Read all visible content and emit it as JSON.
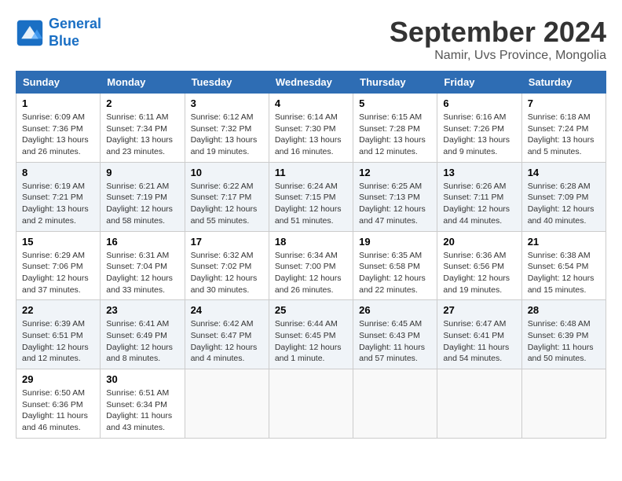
{
  "header": {
    "logo_line1": "General",
    "logo_line2": "Blue",
    "month": "September 2024",
    "location": "Namir, Uvs Province, Mongolia"
  },
  "weekdays": [
    "Sunday",
    "Monday",
    "Tuesday",
    "Wednesday",
    "Thursday",
    "Friday",
    "Saturday"
  ],
  "weeks": [
    [
      {
        "day": "1",
        "content": "Sunrise: 6:09 AM\nSunset: 7:36 PM\nDaylight: 13 hours\nand 26 minutes."
      },
      {
        "day": "2",
        "content": "Sunrise: 6:11 AM\nSunset: 7:34 PM\nDaylight: 13 hours\nand 23 minutes."
      },
      {
        "day": "3",
        "content": "Sunrise: 6:12 AM\nSunset: 7:32 PM\nDaylight: 13 hours\nand 19 minutes."
      },
      {
        "day": "4",
        "content": "Sunrise: 6:14 AM\nSunset: 7:30 PM\nDaylight: 13 hours\nand 16 minutes."
      },
      {
        "day": "5",
        "content": "Sunrise: 6:15 AM\nSunset: 7:28 PM\nDaylight: 13 hours\nand 12 minutes."
      },
      {
        "day": "6",
        "content": "Sunrise: 6:16 AM\nSunset: 7:26 PM\nDaylight: 13 hours\nand 9 minutes."
      },
      {
        "day": "7",
        "content": "Sunrise: 6:18 AM\nSunset: 7:24 PM\nDaylight: 13 hours\nand 5 minutes."
      }
    ],
    [
      {
        "day": "8",
        "content": "Sunrise: 6:19 AM\nSunset: 7:21 PM\nDaylight: 13 hours\nand 2 minutes."
      },
      {
        "day": "9",
        "content": "Sunrise: 6:21 AM\nSunset: 7:19 PM\nDaylight: 12 hours\nand 58 minutes."
      },
      {
        "day": "10",
        "content": "Sunrise: 6:22 AM\nSunset: 7:17 PM\nDaylight: 12 hours\nand 55 minutes."
      },
      {
        "day": "11",
        "content": "Sunrise: 6:24 AM\nSunset: 7:15 PM\nDaylight: 12 hours\nand 51 minutes."
      },
      {
        "day": "12",
        "content": "Sunrise: 6:25 AM\nSunset: 7:13 PM\nDaylight: 12 hours\nand 47 minutes."
      },
      {
        "day": "13",
        "content": "Sunrise: 6:26 AM\nSunset: 7:11 PM\nDaylight: 12 hours\nand 44 minutes."
      },
      {
        "day": "14",
        "content": "Sunrise: 6:28 AM\nSunset: 7:09 PM\nDaylight: 12 hours\nand 40 minutes."
      }
    ],
    [
      {
        "day": "15",
        "content": "Sunrise: 6:29 AM\nSunset: 7:06 PM\nDaylight: 12 hours\nand 37 minutes."
      },
      {
        "day": "16",
        "content": "Sunrise: 6:31 AM\nSunset: 7:04 PM\nDaylight: 12 hours\nand 33 minutes."
      },
      {
        "day": "17",
        "content": "Sunrise: 6:32 AM\nSunset: 7:02 PM\nDaylight: 12 hours\nand 30 minutes."
      },
      {
        "day": "18",
        "content": "Sunrise: 6:34 AM\nSunset: 7:00 PM\nDaylight: 12 hours\nand 26 minutes."
      },
      {
        "day": "19",
        "content": "Sunrise: 6:35 AM\nSunset: 6:58 PM\nDaylight: 12 hours\nand 22 minutes."
      },
      {
        "day": "20",
        "content": "Sunrise: 6:36 AM\nSunset: 6:56 PM\nDaylight: 12 hours\nand 19 minutes."
      },
      {
        "day": "21",
        "content": "Sunrise: 6:38 AM\nSunset: 6:54 PM\nDaylight: 12 hours\nand 15 minutes."
      }
    ],
    [
      {
        "day": "22",
        "content": "Sunrise: 6:39 AM\nSunset: 6:51 PM\nDaylight: 12 hours\nand 12 minutes."
      },
      {
        "day": "23",
        "content": "Sunrise: 6:41 AM\nSunset: 6:49 PM\nDaylight: 12 hours\nand 8 minutes."
      },
      {
        "day": "24",
        "content": "Sunrise: 6:42 AM\nSunset: 6:47 PM\nDaylight: 12 hours\nand 4 minutes."
      },
      {
        "day": "25",
        "content": "Sunrise: 6:44 AM\nSunset: 6:45 PM\nDaylight: 12 hours\nand 1 minute."
      },
      {
        "day": "26",
        "content": "Sunrise: 6:45 AM\nSunset: 6:43 PM\nDaylight: 11 hours\nand 57 minutes."
      },
      {
        "day": "27",
        "content": "Sunrise: 6:47 AM\nSunset: 6:41 PM\nDaylight: 11 hours\nand 54 minutes."
      },
      {
        "day": "28",
        "content": "Sunrise: 6:48 AM\nSunset: 6:39 PM\nDaylight: 11 hours\nand 50 minutes."
      }
    ],
    [
      {
        "day": "29",
        "content": "Sunrise: 6:50 AM\nSunset: 6:36 PM\nDaylight: 11 hours\nand 46 minutes."
      },
      {
        "day": "30",
        "content": "Sunrise: 6:51 AM\nSunset: 6:34 PM\nDaylight: 11 hours\nand 43 minutes."
      },
      {
        "day": "",
        "content": ""
      },
      {
        "day": "",
        "content": ""
      },
      {
        "day": "",
        "content": ""
      },
      {
        "day": "",
        "content": ""
      },
      {
        "day": "",
        "content": ""
      }
    ]
  ]
}
